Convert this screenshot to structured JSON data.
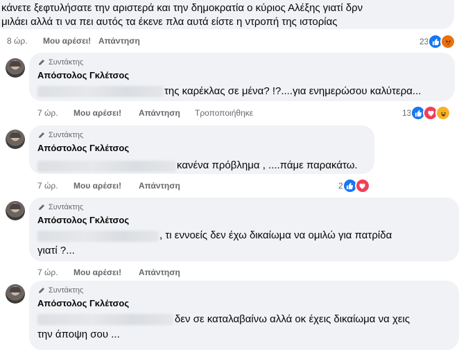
{
  "top_comment": {
    "line1": "κάνετε ξεφτυλήσατε την αριστερά και την δημοκρατία ο κύριος Αλέξης γιατί δρν",
    "line2": "μιλάει αλλά τι να πει αυτός τα έκενε πλα αυτά είστε η ντροπή της ιστορίας",
    "time": "8 ώρ.",
    "like_label": "Μου αρέσει!",
    "reply_label": "Απάντηση",
    "reaction_count": "23"
  },
  "comments": [
    {
      "badge": "Συντάκτης",
      "author": "Απόστολος Γκλέτσος",
      "text_line1": "της καρέκλας σε μένα? !?....για ενημερώσου καλύτερα...",
      "text_line2": "",
      "time": "7 ώρ.",
      "like_label": "Μου αρέσει!",
      "reply_label": "Απάντηση",
      "edited_label": "Τροποποιήθηκε",
      "reaction_count": "13"
    },
    {
      "badge": "Συντάκτης",
      "author": "Απόστολος Γκλέτσος",
      "text_line1": "κανένα πρόβλημα , ....πάμε παρακάτω.",
      "text_line2": "",
      "time": "7 ώρ.",
      "like_label": "Μου αρέσει!",
      "reply_label": "Απάντηση",
      "reaction_count": "2"
    },
    {
      "badge": "Συντάκτης",
      "author": "Απόστολος Γκλέτσος",
      "text_line1": ", τι εννοείς δεν έχω δικαίωμα να ομιλώ για πατρίδα",
      "text_line2": "γιατί ?...",
      "time": "7 ώρ.",
      "like_label": "Μου αρέσει!",
      "reply_label": "Απάντηση"
    },
    {
      "badge": "Συντάκτης",
      "author": "Απόστολος Γκλέτσος",
      "text_line1": "δεν σε καταλαβαίνω αλλά οκ έχεις δικαίωμα να χεις",
      "text_line2": "την άποψη σου ..."
    }
  ],
  "colors": {
    "bubble": "#f0f2f5",
    "like": "#1877f2",
    "love": "#f33e58",
    "angry": "#e9710f",
    "haha": "#f7b125",
    "meta_text": "#65676b"
  },
  "icons": [
    "pencil-icon",
    "like-reaction-icon",
    "love-reaction-icon",
    "angry-reaction-icon",
    "haha-reaction-icon"
  ]
}
